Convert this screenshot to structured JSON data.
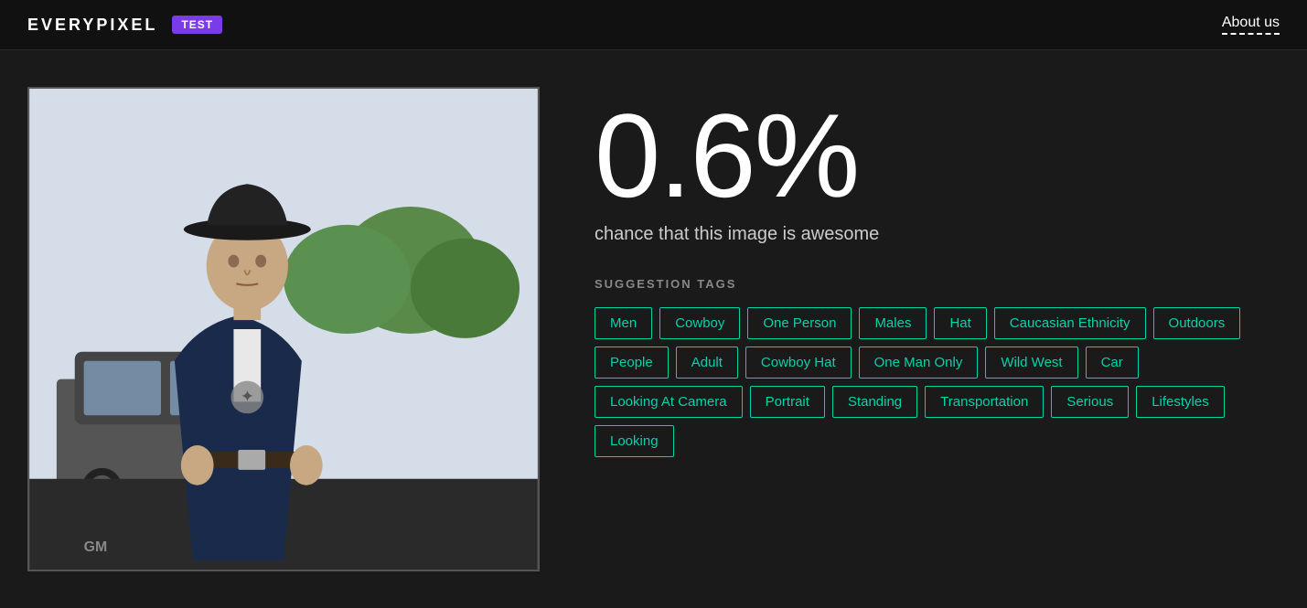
{
  "header": {
    "logo": "EVERYPIXEL",
    "badge": "TEST",
    "about_label": "About us"
  },
  "result": {
    "percentage": "0.6%",
    "subtitle": "chance that this image is awesome",
    "suggestion_label": "SUGGESTION TAGS"
  },
  "tags": [
    {
      "label": "Men"
    },
    {
      "label": "Cowboy"
    },
    {
      "label": "One Person"
    },
    {
      "label": "Males"
    },
    {
      "label": "Hat"
    },
    {
      "label": "Caucasian Ethnicity"
    },
    {
      "label": "Outdoors"
    },
    {
      "label": "People"
    },
    {
      "label": "Adult"
    },
    {
      "label": "Cowboy Hat"
    },
    {
      "label": "One Man Only"
    },
    {
      "label": "Wild West"
    },
    {
      "label": "Car"
    },
    {
      "label": "Looking At Camera"
    },
    {
      "label": "Portrait"
    },
    {
      "label": "Standing"
    },
    {
      "label": "Transportation"
    },
    {
      "label": "Serious"
    },
    {
      "label": "Lifestyles"
    },
    {
      "label": "Looking"
    }
  ]
}
